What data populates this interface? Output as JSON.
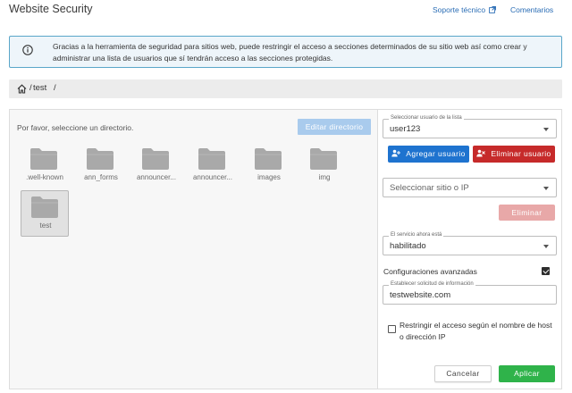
{
  "app": {
    "title": "Website Security",
    "links": {
      "support": "Soporte técnico",
      "comments": "Comentarios"
    }
  },
  "info": {
    "text": "Gracias a la herramienta de seguridad para sitios web, puede restringir el acceso a secciones determinados de su sitio web así como crear y administrar una lista de usuarios que sí tendrán acceso a las secciones protegidas."
  },
  "breadcrumb": {
    "separator": "/",
    "items": [
      "test"
    ]
  },
  "directory": {
    "prompt": "Por favor, seleccione un directorio.",
    "edit_button": "Editar directorio",
    "folders": [
      {
        "label": ".well-known",
        "selected": false
      },
      {
        "label": "ann_forms",
        "selected": false
      },
      {
        "label": "announcer...",
        "selected": false
      },
      {
        "label": "announcer...",
        "selected": false
      },
      {
        "label": "images",
        "selected": false
      },
      {
        "label": "img",
        "selected": false
      },
      {
        "label": "test",
        "selected": true
      }
    ]
  },
  "settings": {
    "user_select": {
      "legend": "Seleccionar usuario de la lista",
      "value": "user123"
    },
    "add_user_button": "Agregar usuario",
    "remove_user_button": "Eliminar usuario",
    "site_select": {
      "placeholder": "Seleccionar sitio o IP"
    },
    "delete_button": "Eliminar",
    "service_select": {
      "legend": "El servicio ahora está",
      "value": "habilitado"
    },
    "advanced": {
      "label": "Configuraciones avanzadas",
      "checked": true
    },
    "info_request": {
      "legend": "Establecer solicitud de información",
      "value": "testwebsite.com"
    },
    "restrict": {
      "label": "Restringir el acceso según el nombre de host o dirección IP",
      "checked": false
    },
    "cancel_button": "Cancelar",
    "apply_button": "Aplicar"
  },
  "colors": {
    "accent": "#1e73cf",
    "danger": "#c62a2a",
    "success": "#2fb34a",
    "info_border": "#5aa6c9"
  },
  "icons": {
    "info": "info-circle-icon",
    "home": "home-icon",
    "external": "external-link-icon",
    "folder": "folder-icon",
    "add_user": "add-user-icon",
    "remove_user": "remove-user-icon",
    "dropdown": "chevron-down-icon"
  }
}
